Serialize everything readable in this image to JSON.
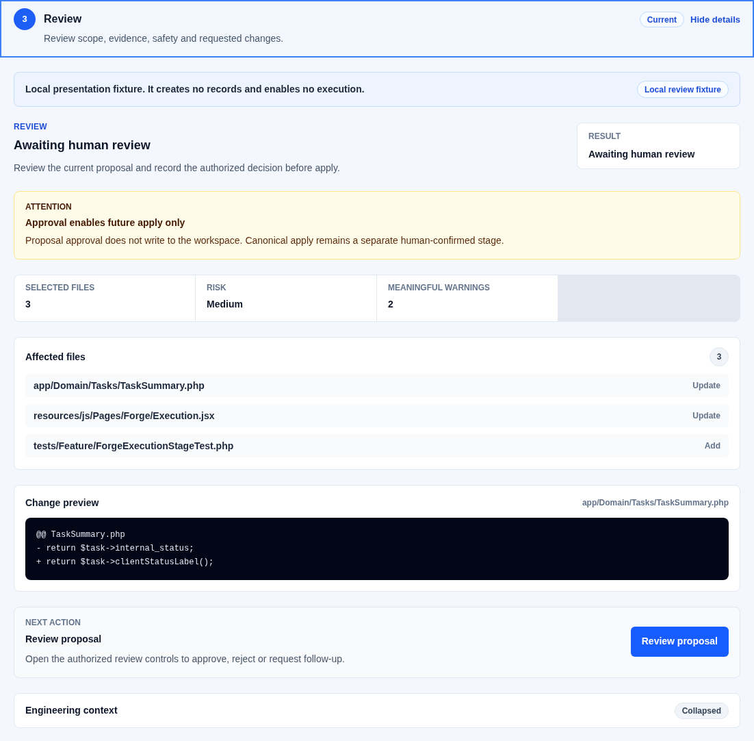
{
  "step": {
    "number": "3",
    "title": "Review",
    "description": "Review scope, evidence, safety and requested changes.",
    "status": "Current",
    "toggle": "Hide details",
    "selected": true
  },
  "notice": {
    "text": "Local presentation fixture. It creates no records and enables no execution.",
    "badge": "Local review fixture"
  },
  "review": {
    "eyebrow": "REVIEW",
    "title": "Awaiting human review",
    "description": "Review the current proposal and record the authorized decision before apply.",
    "result": {
      "label": "RESULT",
      "value": "Awaiting human review"
    }
  },
  "attention": {
    "label": "ATTENTION",
    "title": "Approval enables future apply only",
    "body": "Proposal approval does not write to the workspace. Canonical apply remains a separate human-confirmed stage."
  },
  "stats": [
    {
      "label": "SELECTED FILES",
      "value": "3"
    },
    {
      "label": "RISK",
      "value": "Medium"
    },
    {
      "label": "MEANINGFUL WARNINGS",
      "value": "2"
    }
  ],
  "affected_files": {
    "title": "Affected files",
    "count": "3",
    "files": [
      {
        "path": "app/Domain/Tasks/TaskSummary.php",
        "action": "Update"
      },
      {
        "path": "resources/js/Pages/Forge/Execution.jsx",
        "action": "Update"
      },
      {
        "path": "tests/Feature/ForgeExecutionStageTest.php",
        "action": "Add"
      }
    ]
  },
  "change_preview": {
    "title": "Change preview",
    "path": "app/Domain/Tasks/TaskSummary.php",
    "lines": [
      "@@ TaskSummary.php",
      "- return $task->internal_status;",
      "+ return $task->clientStatusLabel();"
    ]
  },
  "next_action": {
    "label": "NEXT ACTION",
    "title": "Review proposal",
    "body": "Open the authorized review controls to approve, reject or request follow-up.",
    "button": "Review proposal"
  },
  "engineering_context": {
    "title": "Engineering context",
    "status": "Collapsed"
  }
}
